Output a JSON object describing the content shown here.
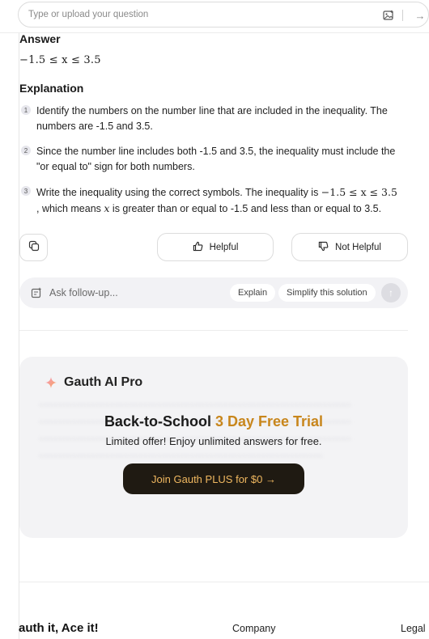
{
  "search": {
    "placeholder": "Type or upload your question",
    "image_icon": "image-upload-icon",
    "go_icon": "arrow-right-icon",
    "go_glyph": "→"
  },
  "answer": {
    "title": "Answer",
    "math": "−1.5 ≤ x ≤ 3.5"
  },
  "explanation": {
    "title": "Explanation",
    "steps": [
      {
        "num": "1",
        "text": "Identify the numbers on the number line that are included in the inequality. The numbers are -1.5 and 3.5."
      },
      {
        "num": "2",
        "text": "Since the number line includes both -1.5 and 3.5, the inequality must include the \"or equal to\" sign for both numbers."
      },
      {
        "num": "3",
        "text_a": "Write the inequality using the correct symbols. The inequality is ",
        "math": "−1.5 ≤ x ≤ 3.5",
        "text_b": ", which means ",
        "var": "x",
        "text_c": " is greater than or equal to -1.5 and less than or equal to 3.5."
      }
    ]
  },
  "feedback": {
    "copy_icon": "copy-icon",
    "helpful_label": "Helpful",
    "helpful_icon": "thumbs-up-icon",
    "not_helpful_label": "Not Helpful",
    "not_helpful_icon": "thumbs-down-icon"
  },
  "followup": {
    "placeholder": "Ask follow-up...",
    "chips": [
      "Explain",
      "Simplify this solution"
    ],
    "send_icon": "arrow-up-icon",
    "send_glyph": "↑"
  },
  "promo": {
    "brand": "Gauth AI Pro",
    "headline_a": "Back-to-School",
    "headline_b": "3 Day Free Trial",
    "subtitle": "Limited offer! Enjoy unlimited answers for free.",
    "cta": "Join Gauth PLUS for $0 →",
    "accent": "#c8861c",
    "cta_bg": "#1f1a12",
    "cta_text_color": "#f0b860"
  },
  "footer": {
    "slogan": "auth it, Ace it!",
    "company": "Company",
    "legal": "Legal"
  }
}
